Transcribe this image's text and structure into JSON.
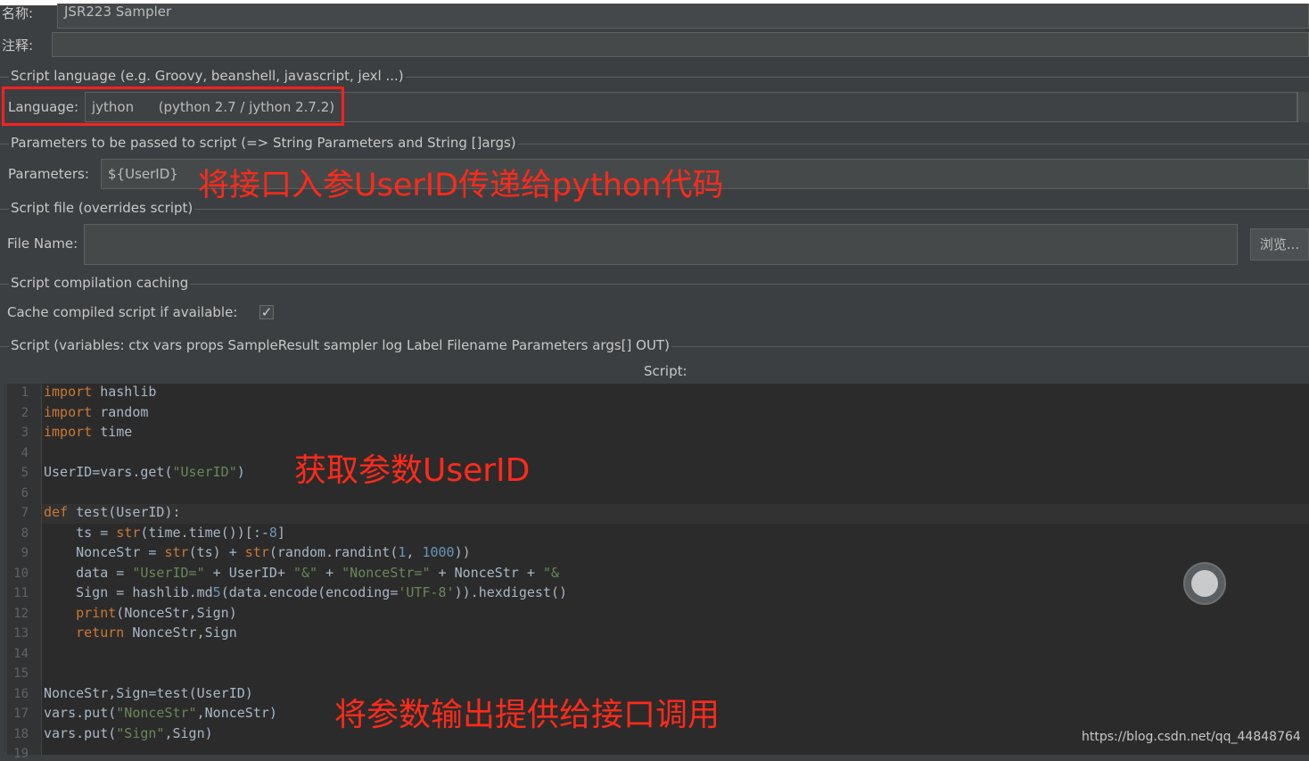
{
  "header": {
    "name_label": "名称:",
    "name_value": "JSR223 Sampler",
    "comment_label": "注释:"
  },
  "language_section": {
    "title": "Script language (e.g. Groovy, beanshell, javascript, jexl ...)",
    "label": "Language:",
    "value": "jython",
    "version": "(python 2.7 / jython 2.7.2)"
  },
  "parameters_section": {
    "title": "Parameters to be passed to script (=> String Parameters and String []args)",
    "label": "Parameters:",
    "value": "${UserID}"
  },
  "file_section": {
    "title": "Script file (overrides script)",
    "label": "File Name:",
    "value": "",
    "browse_button": "浏览..."
  },
  "caching_section": {
    "title": "Script compilation caching",
    "label": "Cache compiled script if available:",
    "checked": true,
    "check_glyph": "✓"
  },
  "script_section": {
    "title": "Script (variables: ctx vars props SampleResult sampler log Label Filename Parameters args[] OUT)",
    "editor_title": "Script:"
  },
  "code_lines": [
    "import hashlib",
    "import random",
    "import time",
    "",
    "UserID=vars.get(\"UserID\")",
    "",
    "def test(UserID):",
    "    ts = str(time.time())[:-8]",
    "    NonceStr = str(ts) + str(random.randint(1, 1000))",
    "    data = \"UserID=\" + UserID+ \"&\" + \"NonceStr=\" + NonceStr + \"&",
    "    Sign = hashlib.md5(data.encode(encoding='UTF-8')).hexdigest()",
    "    print(NonceStr,Sign)",
    "    return NonceStr,Sign",
    "",
    "",
    "NonceStr,Sign=test(UserID)",
    "vars.put(\"NonceStr\",NonceStr)",
    "vars.put(\"Sign\",Sign)",
    ""
  ],
  "line_numbers": [
    "1",
    "2",
    "3",
    "4",
    "5",
    "6",
    "7",
    "8",
    "9",
    "10",
    "11",
    "12",
    "13",
    "14",
    "15",
    "16",
    "17",
    "18",
    "19"
  ],
  "annotations": {
    "params_note": "将接口入参UserID传递给python代码",
    "get_note": "获取参数UserID",
    "output_note": "将参数输出提供给接口调用"
  },
  "watermark": "https://blog.csdn.net/qq_44848764",
  "colors": {
    "panel_bg": "#3c3f41",
    "editor_bg": "#2b2b2b",
    "keyword": "#cc7832",
    "string": "#6a8759",
    "number": "#6897bb",
    "annotation_red": "#ff2a1a"
  }
}
